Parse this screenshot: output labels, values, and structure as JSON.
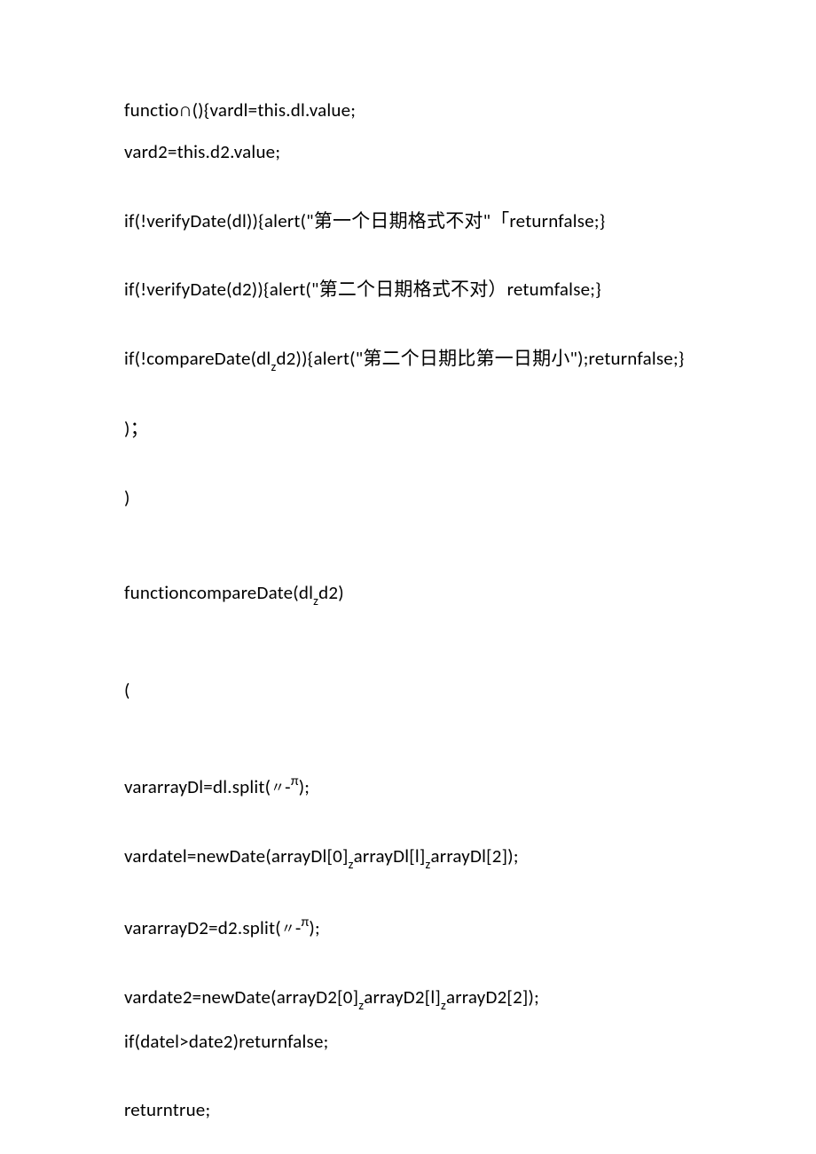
{
  "lines": {
    "l1": "functio∩(){vardl=this.dl.value;",
    "l2": "vard2=this.d2.value;",
    "l3_a": "if(!verifyDate(dl)){alert(\"第一个日期格式不对",
    "l3_b": "\"「",
    "l3_c": "returnfalse;}",
    "l4_a": "if(!verifyDate(d2)){alert(\"第二个日期格式不对",
    "l4_b": "）",
    "l4_c": "retumfalse;}",
    "l5_a": "if(!compareDate(dl",
    "l5_b": "z",
    "l5_c": "d2)){alert(\"第二个日期比第一日期小\");returnfalse;}",
    "l6": ")；",
    "l7": ")",
    "l8_a": "functioncompareDate(dl",
    "l8_b": "z",
    "l8_c": "d2)",
    "l9": "(",
    "l10_a": "vararrayDl=dl.split(",
    "l10_b": "〃",
    "l10_c": "-",
    "l10_d": "π",
    "l10_e": ");",
    "l11_a": "vardatel=newDate(arrayDl[0]",
    "l11_b": "z",
    "l11_c": "arrayDl[l]",
    "l11_d": "z",
    "l11_e": "arrayDl[2]);",
    "l12_a": "vararrayD2=d2.split(",
    "l12_b": "〃",
    "l12_c": "-",
    "l12_d": "π",
    "l12_e": ");",
    "l13_a": "vardate2=newDate(arrayD2[0]",
    "l13_b": "z",
    "l13_c": "arrayD2[l]",
    "l13_d": "z",
    "l13_e": "arrayD2[2]);",
    "l14": "if(datel>date2)returnfalse;",
    "l15": "returntrue;"
  }
}
